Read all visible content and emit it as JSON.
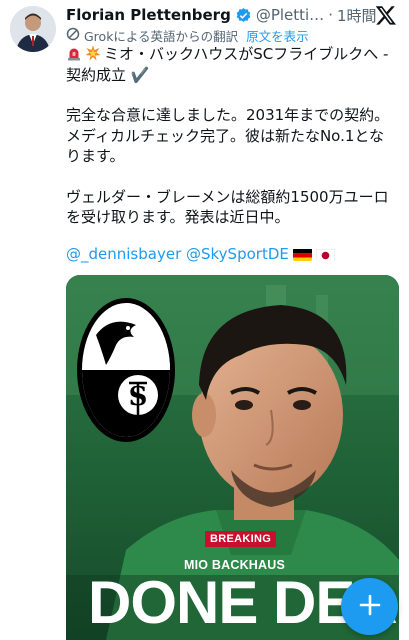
{
  "tweet": {
    "author_name": "Florian Plettenberg",
    "handle": "@Pletti…",
    "separator": "·",
    "time": "1時間",
    "translation_note": "Grokによる英語からの翻訳",
    "show_original": "原文を表示",
    "paragraphs": [
      "ミオ・バックハウスがSCフライブルクへ - 契約成立 ✔️",
      "完全な合意に達しました。2031年までの契約。メディカルチェック完了。彼は新たなNo.1となります。",
      "ヴェルダー・ブレーメンは総額約1500万ユーロを受け取ります。発表は近日中。"
    ],
    "mentions": "@_dennisbayer @SkySportDE",
    "flags": [
      "germany-flag",
      "japan-flag"
    ]
  },
  "media": {
    "badge": "BREAKING",
    "player": "MIO BACKHAUS",
    "headline": "DONE DEAL"
  },
  "colors": {
    "accent": "#1d9bf0",
    "breaking_red": "#c8102e",
    "background_green": "#1f6b3a"
  },
  "icons": [
    "verified-badge-icon",
    "x-logo-icon",
    "grok-icon",
    "siren-icon",
    "collision-icon",
    "plus-icon"
  ]
}
